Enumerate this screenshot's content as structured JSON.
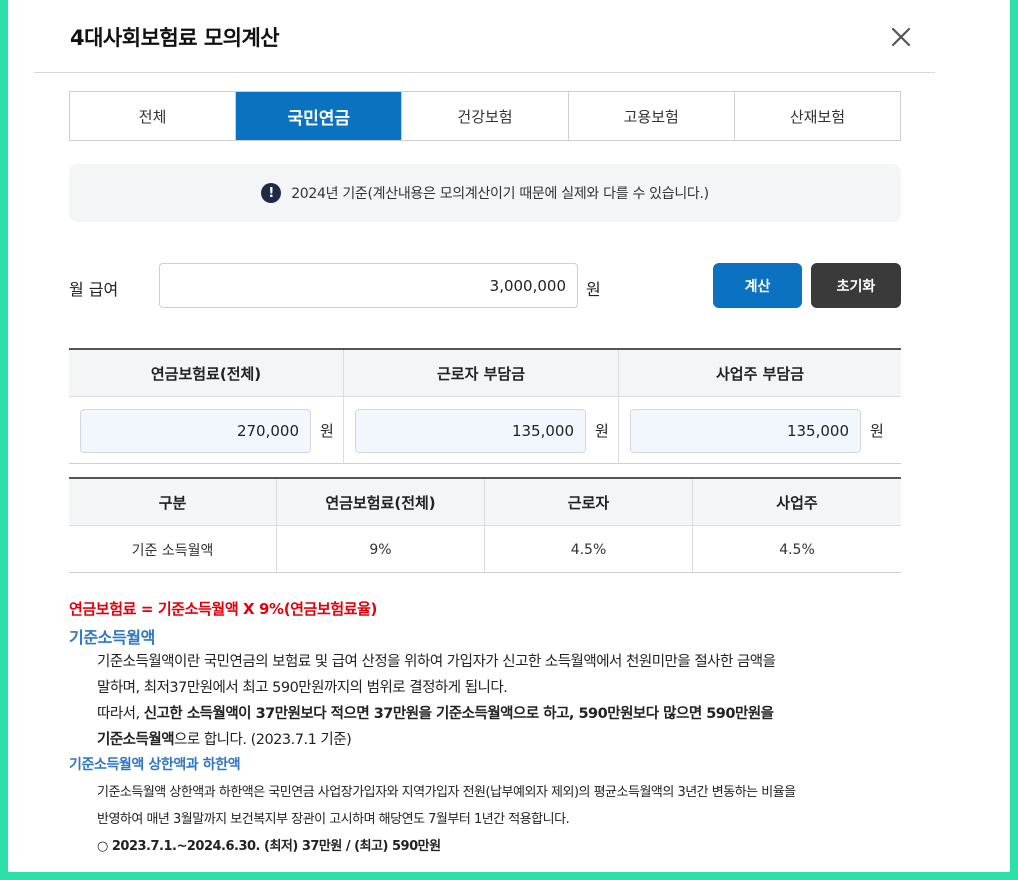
{
  "modal": {
    "title": "4대사회보험료 모의계산"
  },
  "tabs": [
    {
      "label": "전체"
    },
    {
      "label": "국민연금"
    },
    {
      "label": "건강보험"
    },
    {
      "label": "고용보험"
    },
    {
      "label": "산재보험"
    }
  ],
  "notice": {
    "icon": "!",
    "text": "2024년 기준(계산내용은 모의계산이기 때문에 실제와 다를 수 있습니다.)"
  },
  "salary": {
    "label": "월 급여",
    "value": "3,000,000",
    "unit": "원"
  },
  "buttons": {
    "calculate": "계산",
    "reset": "초기화"
  },
  "result": {
    "headers": [
      "연금보험료(전체)",
      "근로자 부담금",
      "사업주 부담금"
    ],
    "values": [
      "270,000",
      "135,000",
      "135,000"
    ],
    "unit": "원"
  },
  "rates": {
    "headers": [
      "구분",
      "연금보험료(전체)",
      "근로자",
      "사업주"
    ],
    "row": [
      "기준 소득월액",
      "9%",
      "4.5%",
      "4.5%"
    ]
  },
  "explanation": {
    "formula": "연금보험료 = 기준소득월액 X 9%(연금보험료율)",
    "section1_title": "기준소득월액",
    "section1_line1": "기준소득월액이란 국민연금의 보험료 및 급여 산정을 위하여 가입자가 신고한 소득월액에서 천원미만을 절사한 금액을",
    "section1_line2": "말하며, 최저37만원에서 최고 590만원까지의 범위로 결정하게 됩니다.",
    "section1_line3_prefix": "따라서, ",
    "section1_line3_bold": "신고한 소득월액이 37만원보다 적으면 37만원을 기준소득월액으로 하고, 590만원보다 많으면 590만원을",
    "section1_line4_bold": "기준소득월액",
    "section1_line4_suffix": "으로 합니다. (2023.7.1 기준)",
    "section2_title": "기준소득월액 상한액과 하한액",
    "section2_line1": "기준소득월액 상한액과 하한액은 국민연금 사업장가입자와 지역가입자 전원(납부예외자 제외)의 평균소득월액의 3년간 변동하는 비율을",
    "section2_line2": "반영하여 매년 3월말까지 보건복지부 장관이 고시하며 해당연도 7월부터 1년간 적용합니다.",
    "section2_line3": "○ 2023.7.1.~2024.6.30. (최저) 37만원 / (최고) 590만원"
  }
}
